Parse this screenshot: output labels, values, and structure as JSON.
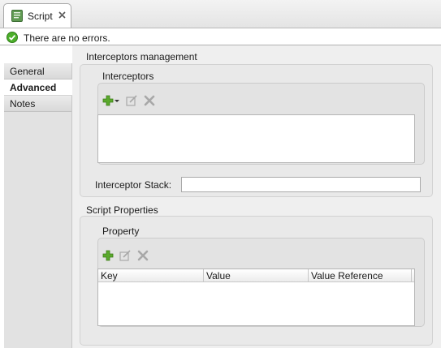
{
  "tab": {
    "label": "Script",
    "icon": "script-file-icon",
    "close_icon": "close-icon"
  },
  "status": {
    "icon": "ok-check-icon",
    "message": "There are no errors."
  },
  "sidebar": {
    "items": [
      {
        "label": "General",
        "active": false
      },
      {
        "label": "Advanced",
        "active": true
      },
      {
        "label": "Notes",
        "active": false
      }
    ]
  },
  "interceptors_management": {
    "title": "Interceptors management",
    "interceptors": {
      "title": "Interceptors",
      "toolbar": {
        "add_icon": "add-icon",
        "dropdown_icon": "dropdown-arrow-icon",
        "edit_icon": "edit-icon",
        "delete_icon": "delete-icon"
      },
      "items": []
    },
    "stack": {
      "label": "Interceptor Stack:",
      "value": ""
    }
  },
  "script_properties": {
    "title": "Script Properties",
    "property": {
      "title": "Property",
      "toolbar": {
        "add_icon": "add-icon",
        "edit_icon": "edit-icon",
        "delete_icon": "delete-icon"
      },
      "columns": [
        "Key",
        "Value",
        "Value Reference"
      ],
      "rows": []
    }
  },
  "colors": {
    "add_green": "#5aa92c",
    "ok_green": "#4caf2a",
    "disabled_gray": "#a8a8a8"
  }
}
